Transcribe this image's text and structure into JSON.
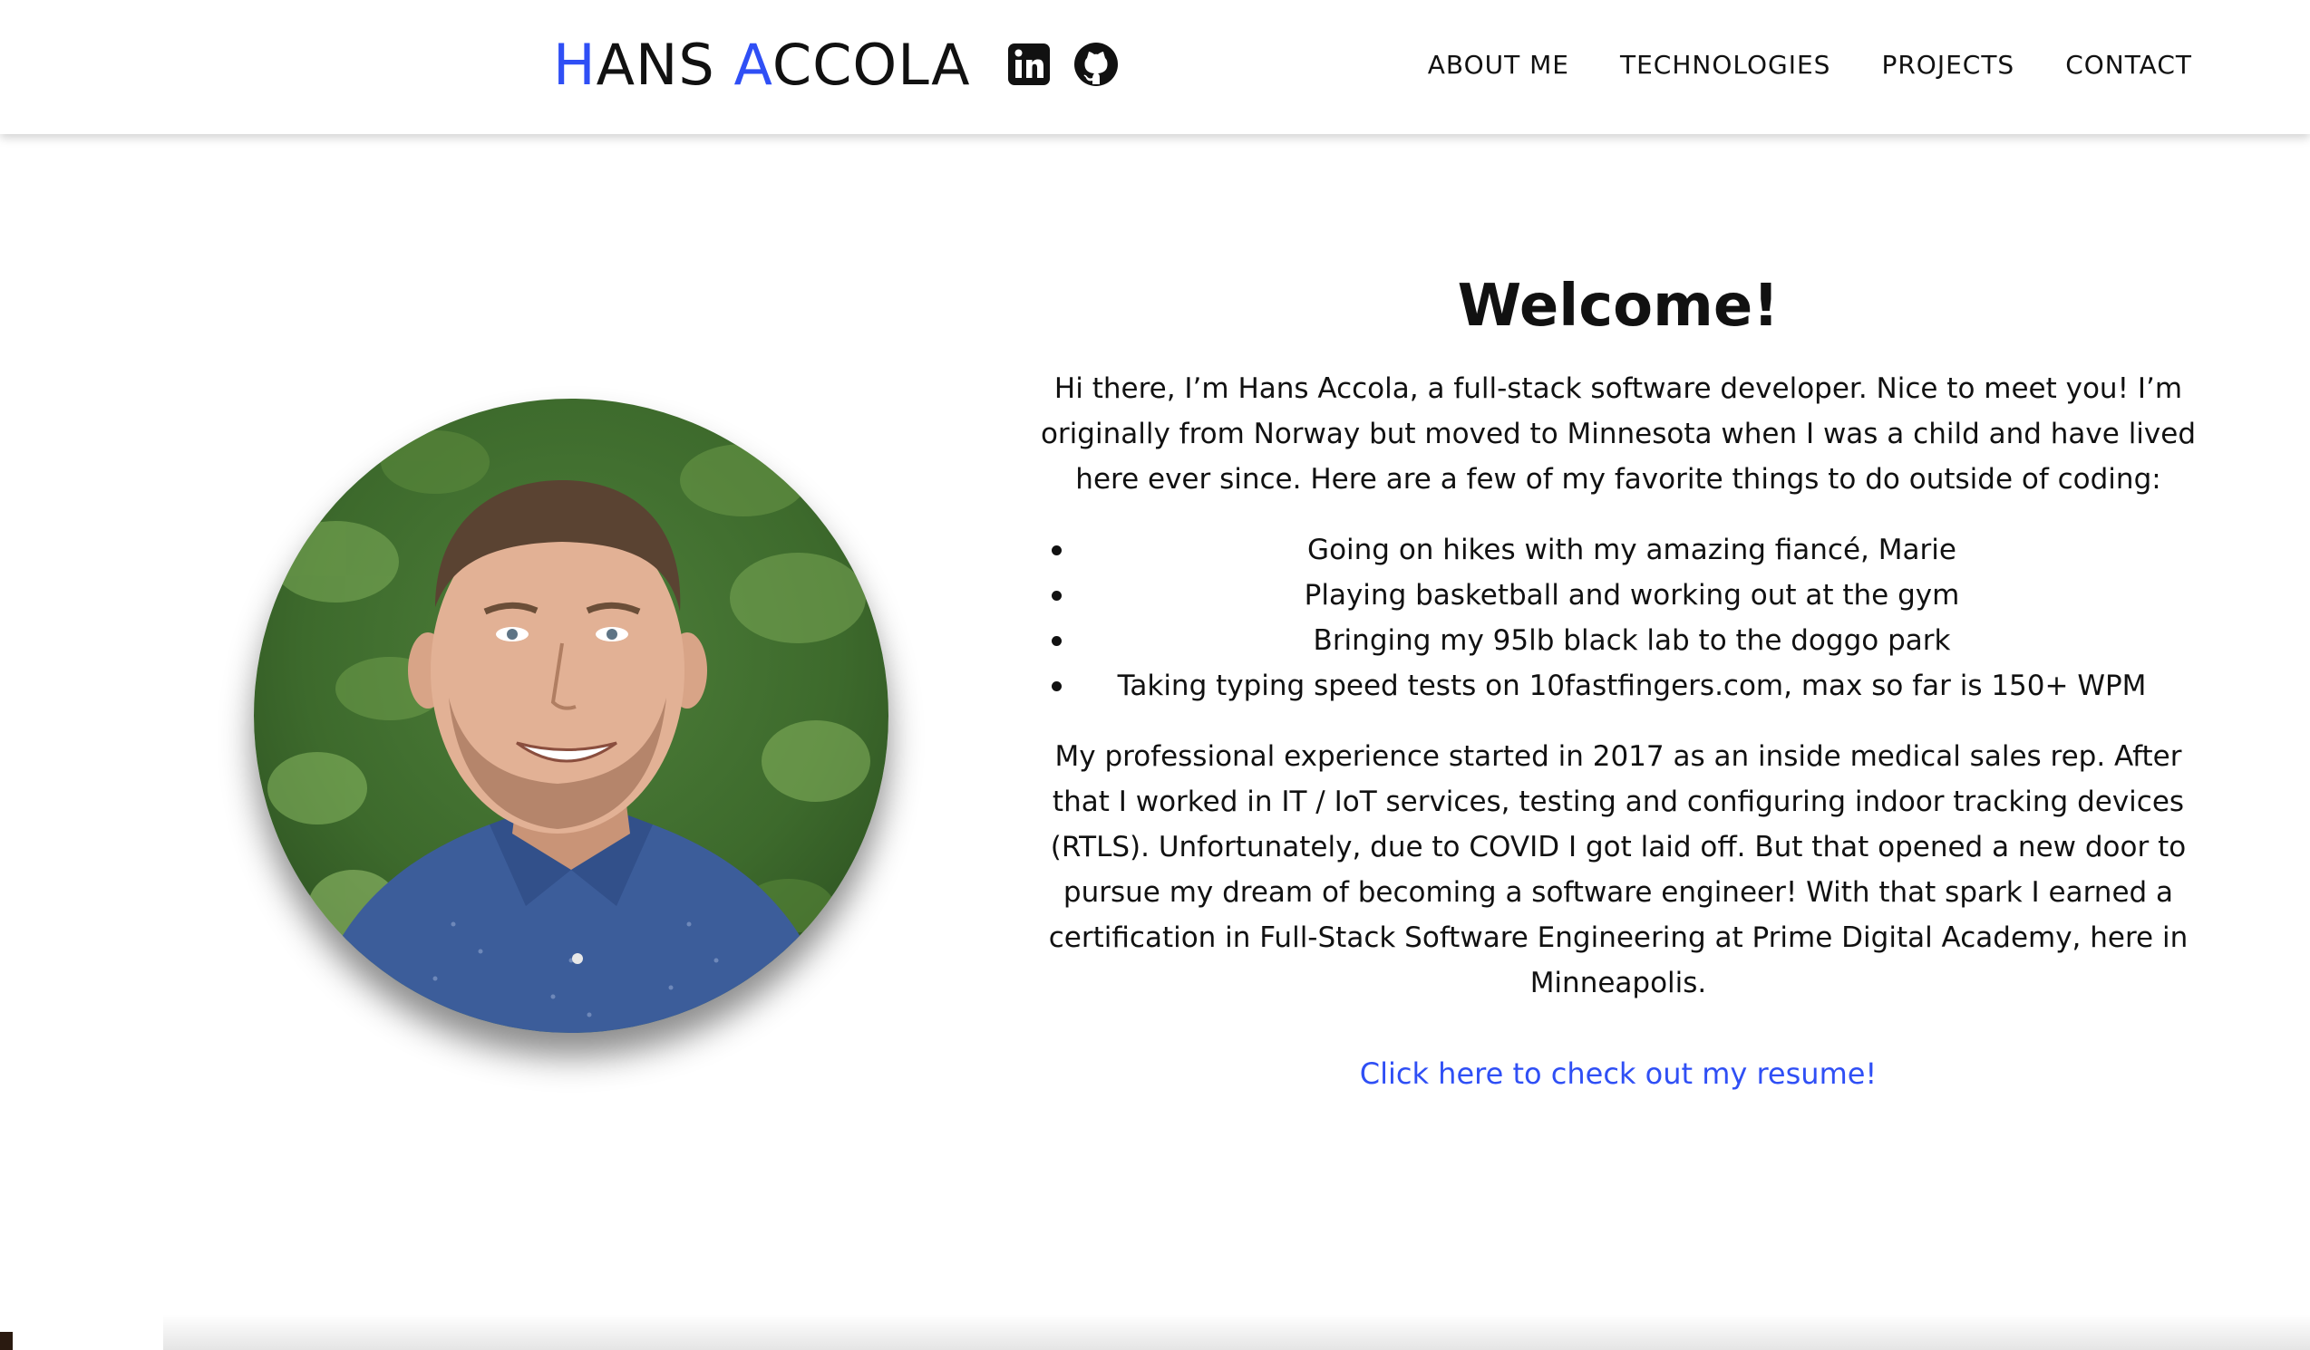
{
  "header": {
    "brand": {
      "first_initial": "H",
      "first_rest": "ANS ",
      "last_initial": "A",
      "last_rest": "CCOLA"
    },
    "social": [
      "linkedin-icon",
      "github-icon"
    ],
    "nav": [
      {
        "label": "ABOUT ME"
      },
      {
        "label": "TECHNOLOGIES"
      },
      {
        "label": "PROJECTS"
      },
      {
        "label": "CONTACT"
      }
    ]
  },
  "about": {
    "title": "Welcome!",
    "intro": "Hi there, I’m Hans Accola, a full-stack software developer. Nice to meet you! I’m originally from Norway but moved to Minnesota when I was a child and have lived here ever since. Here are a few of my favorite things to do outside of coding:",
    "hobbies": [
      "Going on hikes with my amazing fiancé, Marie",
      "Playing basketball and working out at the gym",
      "Bringing my 95lb black lab to the doggo park",
      "Taking typing speed tests on 10fastfingers.com, max so far is 150+ WPM"
    ],
    "experience": "My professional experience started in 2017 as an inside medical sales rep. After that I worked in IT / IoT services, testing and configuring indoor tracking devices (RTLS). Unfortunately, due to COVID I got laid off. But that opened a new door to pursue my dream of becoming a software engineer! With that spark I earned a certification in Full-Stack Software Engineering at Prime Digital Academy, here in Minneapolis.",
    "resume_link": "Click here to check out my resume!"
  },
  "colors": {
    "accent": "#2f4ff5",
    "text": "#111111",
    "background": "#ffffff"
  }
}
